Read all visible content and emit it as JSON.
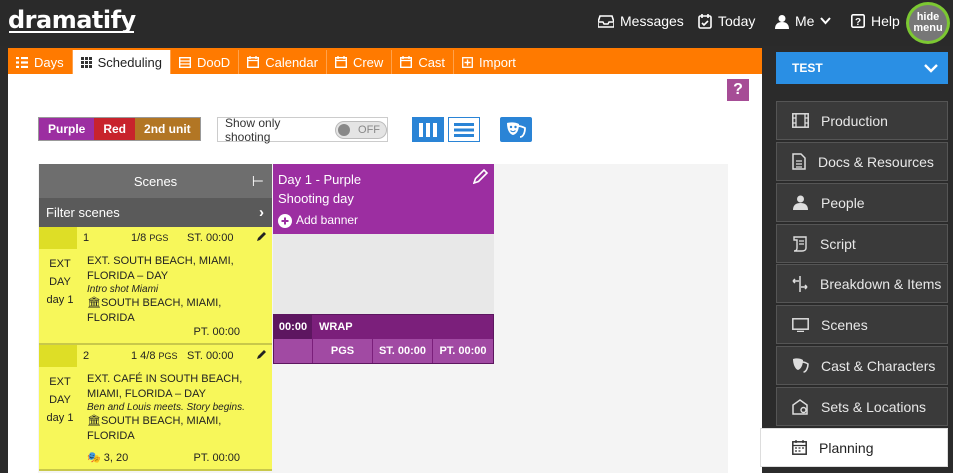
{
  "header": {
    "logo": "dramatify",
    "nav": [
      {
        "label": "Messages",
        "icon": "inbox-icon"
      },
      {
        "label": "Today",
        "icon": "calendar-check-icon"
      },
      {
        "label": "Me",
        "icon": "user-icon"
      },
      {
        "label": "Help",
        "icon": "help-icon"
      }
    ],
    "hide_menu_line1": "hide",
    "hide_menu_line2": "menu"
  },
  "tabs": [
    {
      "label": "Days",
      "icon": "list-icon",
      "active": false
    },
    {
      "label": "Scheduling",
      "icon": "grid-icon",
      "active": true
    },
    {
      "label": "DooD",
      "icon": "table-icon",
      "active": false
    },
    {
      "label": "Calendar",
      "icon": "calendar-icon",
      "active": false
    },
    {
      "label": "Crew",
      "icon": "calendar-icon",
      "active": false
    },
    {
      "label": "Cast",
      "icon": "calendar-icon",
      "active": false
    },
    {
      "label": "Import",
      "icon": "plus-square-icon",
      "active": false
    }
  ],
  "help_button": "?",
  "units": [
    {
      "label": "Purple",
      "color": "#9c2ea1"
    },
    {
      "label": "Red",
      "color": "#c8232c"
    },
    {
      "label": "2nd unit",
      "color": "#b27624"
    }
  ],
  "show_only_shooting": {
    "label": "Show only shooting",
    "state": "OFF"
  },
  "scenes_panel": {
    "title": "Scenes",
    "filter_label": "Filter scenes",
    "scenes": [
      {
        "number": "1",
        "pages": "1/8",
        "pages_unit": "PGS",
        "start": "ST. 00:00",
        "ext": "EXT",
        "time": "DAY",
        "day": "day 1",
        "heading": "EXT. SOUTH BEACH, MIAMI, FLORIDA – DAY",
        "synopsis": "Intro shot Miami",
        "location": "SOUTH BEACH, MIAMI, FLORIDA",
        "cast": "",
        "pt": "PT. 00:00"
      },
      {
        "number": "2",
        "pages": "1 4/8",
        "pages_unit": "PGS",
        "start": "ST. 00:00",
        "ext": "EXT",
        "time": "DAY",
        "day": "day 1",
        "heading": "EXT. CAFÉ IN SOUTH BEACH, MIAMI, FLORIDA – DAY",
        "synopsis": "Ben and Louis meets. Story begins.",
        "location": "SOUTH BEACH, MIAMI, FLORIDA",
        "cast": "3, 20",
        "pt": "PT. 00:00"
      }
    ]
  },
  "day_column": {
    "title": "Day 1 - Purple",
    "subtitle": "Shooting day",
    "add_banner": "Add banner",
    "wrap_time": "00:00",
    "wrap_label": "WRAP",
    "pgs": "PGS",
    "st": "ST. 00:00",
    "pt": "PT. 00:00"
  },
  "sidebar": {
    "project": "TEST",
    "items": [
      {
        "label": "Production",
        "icon": "film-icon",
        "active": false
      },
      {
        "label": "Docs & Resources",
        "icon": "document-icon",
        "active": false
      },
      {
        "label": "People",
        "icon": "people-icon",
        "active": false
      },
      {
        "label": "Script",
        "icon": "script-icon",
        "active": false
      },
      {
        "label": "Breakdown & Items",
        "icon": "breakdown-icon",
        "active": false
      },
      {
        "label": "Scenes",
        "icon": "monitor-icon",
        "active": false
      },
      {
        "label": "Cast & Characters",
        "icon": "masks-icon",
        "active": false
      },
      {
        "label": "Sets & Locations",
        "icon": "location-icon",
        "active": false
      },
      {
        "label": "Planning",
        "icon": "calendar-icon",
        "active": true
      }
    ]
  }
}
